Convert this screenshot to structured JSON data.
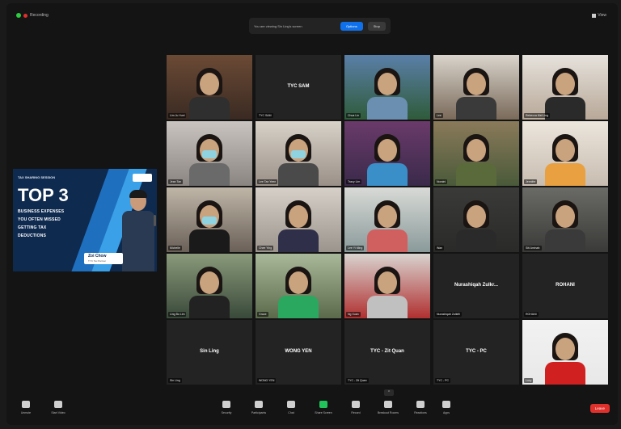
{
  "window": {
    "recording_label": "Recording",
    "view_label": "View"
  },
  "banner": {
    "text": "You are viewing Sin Ling's screen",
    "primary_label": "Options",
    "secondary_label": "Stop"
  },
  "share": {
    "series": "TAX SHARING SESSION",
    "headline": "TOP 3",
    "lines": [
      "BUSINESS EXPENSES",
      "YOU OFTEN MISSED",
      "GETTING TAX",
      "DEDUCTIONS"
    ],
    "speaker_name": "Zoi Chow",
    "speaker_role": "TYC Tax Partner"
  },
  "participants": [
    {
      "name": "Lim Ju Huei",
      "video": true
    },
    {
      "name": "TYC SAM",
      "video": false
    },
    {
      "name": "Chua Lin",
      "video": true
    },
    {
      "name": "Lee",
      "video": true
    },
    {
      "name": "Rebecca Mei Ling",
      "video": true
    },
    {
      "name": "Jean Tan",
      "video": true
    },
    {
      "name": "Lee Tan Yeen",
      "video": true
    },
    {
      "name": "Tracy Lim",
      "video": true
    },
    {
      "name": "Noraini",
      "video": true
    },
    {
      "name": "Jennifer",
      "video": true
    },
    {
      "name": "Michelle",
      "video": true
    },
    {
      "name": "Chee Ying",
      "video": true
    },
    {
      "name": "Lee Yi Ming",
      "video": true
    },
    {
      "name": "Wan",
      "video": true
    },
    {
      "name": "Siti Aminah",
      "video": true
    },
    {
      "name": "Ling Bo Lim",
      "video": true
    },
    {
      "name": "Grace",
      "video": true
    },
    {
      "name": "Ng Xuan",
      "video": true
    },
    {
      "name": "Nurashiqah Zulkifli",
      "video": false
    },
    {
      "name": "ROHANI",
      "video": false
    },
    {
      "name": "Sin Ling",
      "video": false
    },
    {
      "name": "WONG YEN",
      "video": false
    },
    {
      "name": "TYC - Zit Quan",
      "video": false
    },
    {
      "name": "TYC - PC",
      "video": false
    },
    {
      "name": "Lucy",
      "video": true
    }
  ],
  "participant_center_labels": {
    "tile_1": "TYC SAM",
    "tile_18": "Nurashiqah Zulkr...",
    "tile_19": "ROHANI",
    "tile_20": "Sin Ling",
    "tile_21": "WONG YEN",
    "tile_22": "TYC - Zit Quan",
    "tile_23": "TYC - PC"
  },
  "toolbar": {
    "unmute": "Unmute",
    "start_video": "Start Video",
    "security": "Security",
    "participants": "Participants",
    "chat": "Chat",
    "share_screen": "Share Screen",
    "record": "Record",
    "breakout": "Breakout Rooms",
    "reactions": "Reactions",
    "apps": "Apps",
    "end": "Leave"
  },
  "colors": {
    "active_speaker": "#c8c83a",
    "share_bg": "#0f2a4f",
    "end_red": "#e0302b",
    "primary_blue": "#0e71eb"
  }
}
